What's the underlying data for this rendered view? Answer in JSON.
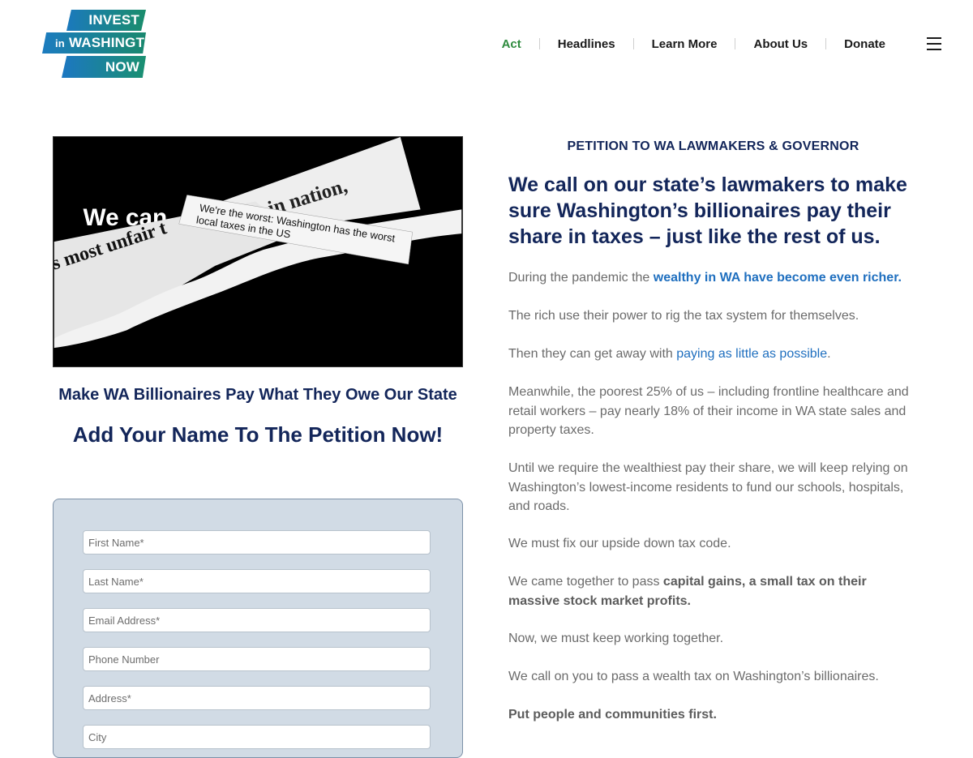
{
  "logo": {
    "line1": "INVEST",
    "line2_small": "in",
    "line2": "WASHINGTON",
    "line3": "NOW"
  },
  "nav": {
    "items": [
      "Act",
      "Headlines",
      "Learn More",
      "About Us",
      "Donate"
    ],
    "active": "Act",
    "menu_icon": "hamburger-icon"
  },
  "hero": {
    "strip1": "cture in nation,",
    "strip2": "s most unfair t",
    "strip3_line1": "We're the worst: Washington has the worst",
    "strip3_line2": "local taxes in the US",
    "background_text": "We can"
  },
  "left": {
    "subtitle": "Make WA Billionaires Pay What They Owe Our State",
    "cta": "Add Your Name To The Petition Now!"
  },
  "form": {
    "fields": [
      {
        "placeholder": "First Name*"
      },
      {
        "placeholder": "Last Name*"
      },
      {
        "placeholder": "Email Address*"
      },
      {
        "placeholder": "Phone Number"
      },
      {
        "placeholder": "Address*"
      },
      {
        "placeholder": "City"
      }
    ]
  },
  "right": {
    "eyebrow": "PETITION TO WA LAWMAKERS & GOVERNOR",
    "headline": "We call on our state’s lawmakers to make sure Washington’s billionaires pay their share in taxes – just like the rest of us.",
    "p1_text": "During the pandemic the ",
    "p1_link": "wealthy in WA have become even richer.",
    "p2": "The rich use their power to rig the tax system for themselves.",
    "p3_text": "Then they can get away with ",
    "p3_link": "paying as little as possible",
    "p3_end": ".",
    "p4": "Meanwhile, the poorest 25% of us – including frontline healthcare and retail workers – pay nearly 18% of their income in WA state sales and property taxes.",
    "p5": "Until we require the wealthiest pay their share, we will keep relying on Washington’s lowest-income residents to fund our schools, hospitals, and roads.",
    "p6": "We must fix our upside down tax code.",
    "p7_text": "We came together to pass ",
    "p7_bold": "capital gains, a small tax on their massive stock market profits.",
    "p8": "Now, we must keep working together.",
    "p9": "We call on you to pass a wealth tax on Washington’s billionaires.",
    "p10": "Put people and communities first."
  },
  "colors": {
    "navy": "#13265a",
    "link_blue": "#1f6fbf",
    "active_green": "#2e8b3e",
    "form_bg": "#d1dbe5"
  }
}
